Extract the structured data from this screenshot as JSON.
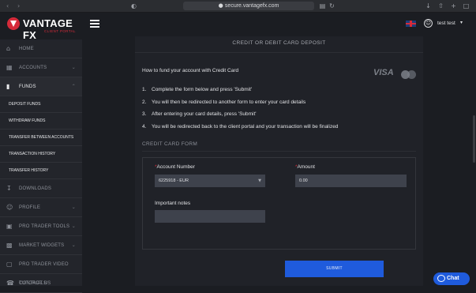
{
  "browser": {
    "url": "secure.vantagefx.com",
    "icons": [
      "back-icon",
      "forward-icon",
      "shield-icon",
      "lock-icon",
      "translate-icon",
      "reload-icon",
      "download-icon",
      "share-icon",
      "new-tab-icon",
      "tabs-icon"
    ]
  },
  "logo": {
    "name": "VANTAGE FX",
    "sub": "CLIENT PORTAL"
  },
  "sidebar": {
    "items": [
      {
        "label": "HOME",
        "icon": "home-icon"
      },
      {
        "label": "ACCOUNTS",
        "icon": "accounts-icon"
      },
      {
        "label": "FUNDS",
        "icon": "funds-icon"
      },
      {
        "label": "DOWNLOADS",
        "icon": "download-icon"
      },
      {
        "label": "PROFILE",
        "icon": "profile-icon"
      },
      {
        "label": "PRO TRADER TOOLS",
        "icon": "tools-icon"
      },
      {
        "label": "MARKET WIDGETS",
        "icon": "widgets-icon"
      },
      {
        "label": "PRO TRADER VIDEO TUTORIALS",
        "icon": "video-icon"
      },
      {
        "label": "CONTACT US",
        "icon": "phone-icon"
      }
    ],
    "funds_sub": [
      "DEPOSIT FUNDS",
      "WITHDRAW FUNDS",
      "TRANSFER BETWEEN ACCOUNTS",
      "TRANSACTION HISTORY",
      "TRANSFER HISTORY"
    ]
  },
  "topbar": {
    "user": "test test"
  },
  "panel": {
    "title": "CREDIT OR DEBIT CARD DEPOSIT",
    "howto": "How to fund your account with Credit Card",
    "card_brand": "VISA",
    "steps": [
      {
        "n": "1.",
        "text": "Complete the form below and press 'Submit'"
      },
      {
        "n": "2.",
        "text": "You will then be redirected to another form to enter your card details"
      },
      {
        "n": "3.",
        "text": "After entering your card details, press 'Submit'"
      },
      {
        "n": "4.",
        "text": "You will be redirected back to the client portal and your transaction will be finalized"
      }
    ],
    "form_title": "CREDIT CARD FORM",
    "account_label": "Account Number",
    "account_value": "6225918 - EUR",
    "amount_label": "Amount",
    "amount_value": "0.00",
    "notes_label": "Important notes",
    "notes_value": "",
    "required_mark": "*",
    "submit": "SUBMIT"
  },
  "chat": {
    "label": "Chat"
  },
  "colors": {
    "accent": "#1f5bdc",
    "brand_red": "#d52b3a",
    "panel_bg": "#202228",
    "input_bg": "#3e424c"
  }
}
